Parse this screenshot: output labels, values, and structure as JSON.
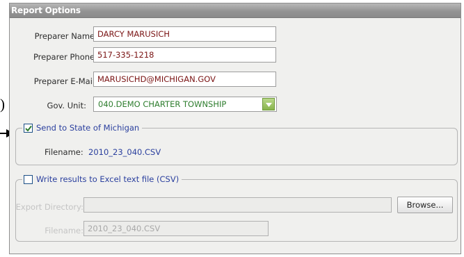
{
  "edge": {
    "paren": ")"
  },
  "panel": {
    "title": "Report Options"
  },
  "preparer": {
    "name_label": "Preparer Name:",
    "name_value": "DARCY MARUSICH",
    "phone_label": "Preparer Phone:",
    "phone_value": "517-335-1218",
    "email_label": "Preparer E-Mail:",
    "email_value": "MARUSICHD@MICHIGAN.GOV",
    "gov_unit_label": "Gov. Unit:",
    "gov_unit_value": "040.DEMO CHARTER TOWNSHIP"
  },
  "send_state": {
    "checked": true,
    "label": "Send to State of Michigan",
    "filename_label": "Filename:",
    "filename_value": "2010_23_040.CSV"
  },
  "excel": {
    "checked": false,
    "label": "Write results to Excel text file (CSV)",
    "export_dir_label": "Export Directory:",
    "export_dir_value": "",
    "browse_label": "Browse...",
    "filename_label": "Filename:",
    "filename_value": "2010_23_040.CSV"
  },
  "colors": {
    "header": "#949494",
    "accent_blue": "#2a3f9e",
    "value_red": "#7a1414",
    "value_green": "#2e7d2e"
  }
}
